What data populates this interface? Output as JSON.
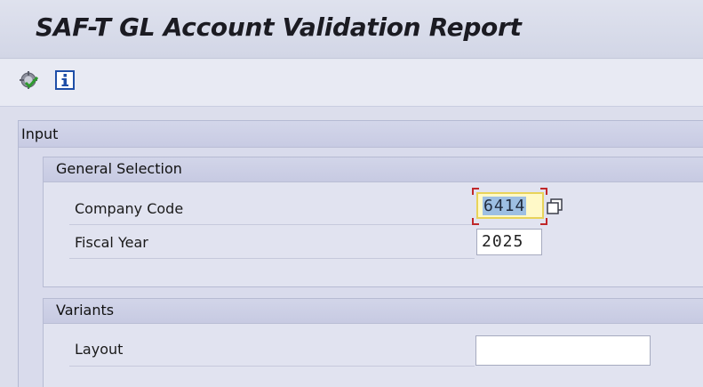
{
  "title": "SAF-T GL Account Validation Report",
  "toolbar": {
    "icons": [
      "execute-icon",
      "info-icon"
    ]
  },
  "input_frame": {
    "label": "Input",
    "general_selection": {
      "label": "General Selection",
      "company_code": {
        "label": "Company Code",
        "value": "6414"
      },
      "fiscal_year": {
        "label": "Fiscal Year",
        "value": "2025"
      }
    },
    "variants": {
      "label": "Variants",
      "layout": {
        "label": "Layout",
        "value": ""
      }
    }
  },
  "colors": {
    "background": "#e4e7f1",
    "focus_field": "#fff9c8",
    "selection": "#9dbfe3",
    "focus_marker": "#c0282a"
  }
}
